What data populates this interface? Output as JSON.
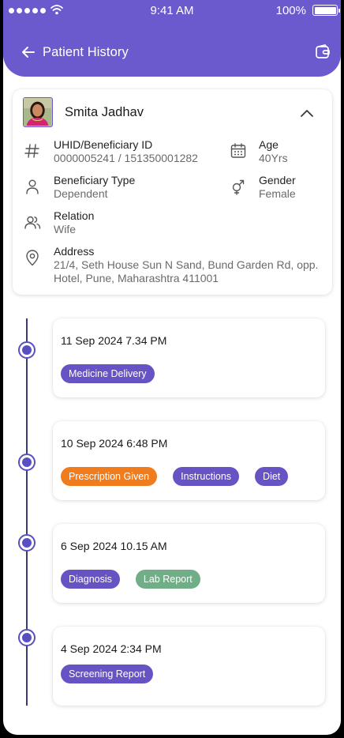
{
  "status_bar": {
    "time": "9:41 AM",
    "battery_pct": "100%"
  },
  "header": {
    "title": "Patient History"
  },
  "patient": {
    "name": "Smita Jadhav",
    "fields": {
      "uhid": {
        "label": "UHID/Beneficiary ID",
        "value": "0000005241 / 151350001282"
      },
      "age": {
        "label": "Age",
        "value": "40Yrs"
      },
      "beneficiary_type": {
        "label": "Beneficiary Type",
        "value": "Dependent"
      },
      "gender": {
        "label": "Gender",
        "value": "Female"
      },
      "relation": {
        "label": "Relation",
        "value": "Wife"
      },
      "address": {
        "label": "Address",
        "line1": "21/4, Seth House Sun N Sand, Bund Garden Rd, opp.",
        "line2": "Hotel, Pune, Maharashtra 411001"
      }
    }
  },
  "timeline": [
    {
      "date": "11 Sep 2024 7.34 PM",
      "tags": [
        {
          "label": "Medicine Delivery",
          "color": "#6753c4"
        }
      ]
    },
    {
      "date": "10 Sep 2024 6:48 PM",
      "tags": [
        {
          "label": "Prescription Given",
          "color": "#f07c1d"
        },
        {
          "label": "Instructions",
          "color": "#6753c4"
        },
        {
          "label": "Diet",
          "color": "#6753c4"
        }
      ]
    },
    {
      "date": "6 Sep 2024 10.15 AM",
      "tags": [
        {
          "label": "Diagnosis",
          "color": "#6753c4"
        },
        {
          "label": "Lab Report",
          "color": "#6fae87"
        }
      ]
    },
    {
      "date": "4 Sep 2024 2:34 PM",
      "tags": [
        {
          "label": "Screening Report",
          "color": "#6753c4"
        }
      ]
    }
  ],
  "colors": {
    "primary": "#6a5acd",
    "tag_purple": "#6753c4",
    "tag_orange": "#f07c1d",
    "tag_green": "#6fae87"
  },
  "icons": [
    "back-arrow-icon",
    "wallet-icon",
    "chevron-up-icon",
    "hash-icon",
    "calendar-icon",
    "person-icon",
    "gender-icon",
    "people-icon",
    "location-pin-icon"
  ]
}
